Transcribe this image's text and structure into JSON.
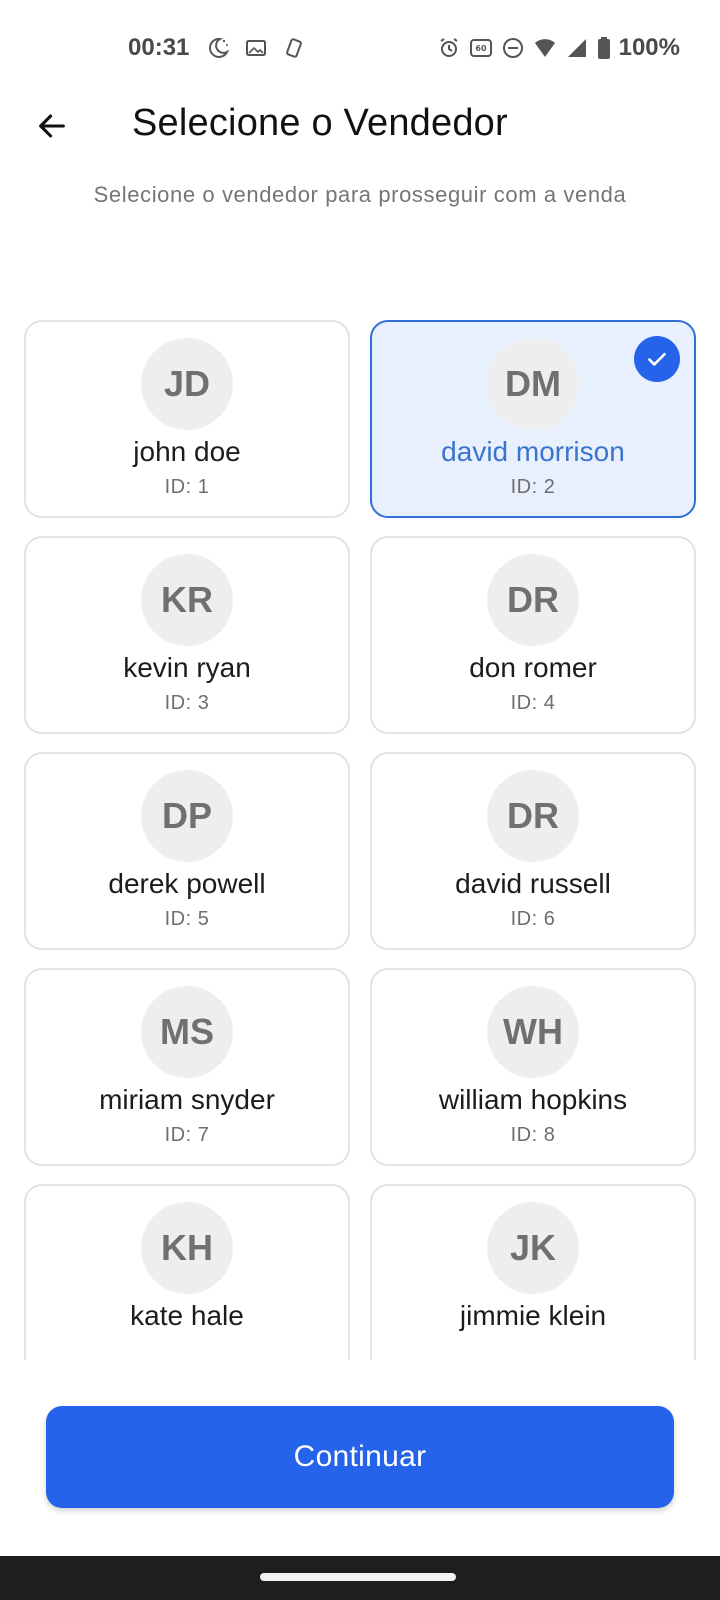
{
  "status_bar": {
    "time": "00:31",
    "battery": "100%",
    "icons_left": [
      "night-mode-icon",
      "image-icon",
      "rotate-device-icon"
    ],
    "icons_right": [
      "alarm-icon",
      "refresh-rate-60hz-icon",
      "do-not-disturb-icon",
      "wifi-icon",
      "signal-icon",
      "battery-icon"
    ]
  },
  "header": {
    "title": "Selecione o Vendedor",
    "subtitle": "Selecione o vendedor para prosseguir com a venda"
  },
  "sellers": [
    {
      "initials": "JD",
      "name": "john doe",
      "id": "ID: 1",
      "selected": false
    },
    {
      "initials": "DM",
      "name": "david morrison",
      "id": "ID: 2",
      "selected": true
    },
    {
      "initials": "KR",
      "name": "kevin ryan",
      "id": "ID: 3",
      "selected": false
    },
    {
      "initials": "DR",
      "name": "don romer",
      "id": "ID: 4",
      "selected": false
    },
    {
      "initials": "DP",
      "name": "derek powell",
      "id": "ID: 5",
      "selected": false
    },
    {
      "initials": "DR",
      "name": "david russell",
      "id": "ID: 6",
      "selected": false
    },
    {
      "initials": "MS",
      "name": "miriam snyder",
      "id": "ID: 7",
      "selected": false
    },
    {
      "initials": "WH",
      "name": "william hopkins",
      "id": "ID: 8",
      "selected": false
    },
    {
      "initials": "KH",
      "name": "kate hale",
      "id": "",
      "selected": false
    },
    {
      "initials": "JK",
      "name": "jimmie klein",
      "id": "",
      "selected": false
    }
  ],
  "actions": {
    "continue_label": "Continuar"
  },
  "colors": {
    "accent": "#2563eb",
    "selected_border": "#2f6fd6",
    "selected_background": "#e9f0fd",
    "selected_text": "#3a74cc"
  }
}
